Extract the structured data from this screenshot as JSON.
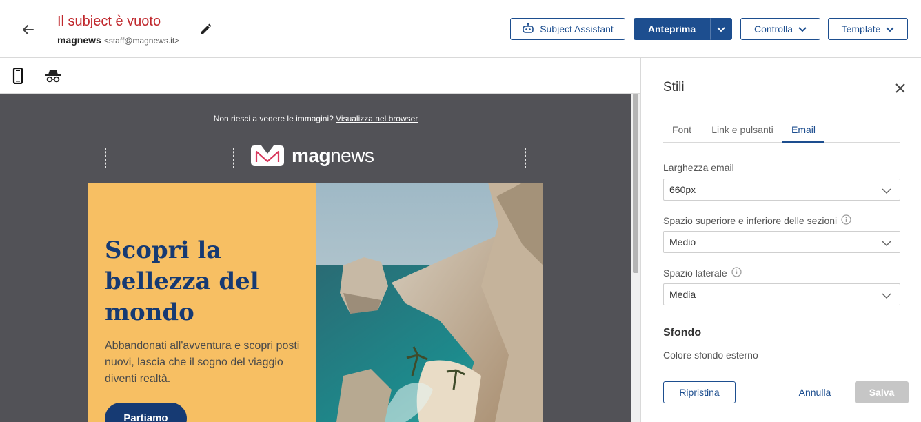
{
  "header": {
    "subject": "Il subject è vuoto",
    "sender_name": "magnews",
    "sender_email": "<staff@magnews.it>",
    "subject_assistant_label": "Subject Assistant",
    "preview_label": "Anteprima",
    "check_label": "Controlla",
    "template_label": "Template"
  },
  "email": {
    "browser_prompt": "Non riesci a vedere le immagini?",
    "browser_link": "Visualizza nel browser",
    "logo_bold": "mag",
    "logo_light": "news",
    "hero_title": "Scopri la bellezza del mondo",
    "hero_text": "Abbandonati all'avventura e scopri posti nuovi, lascia che il sogno del viaggio diventi realtà.",
    "cta_label": "Partiamo"
  },
  "panel": {
    "title": "Stili",
    "tabs": [
      {
        "label": "Font"
      },
      {
        "label": "Link e pulsanti"
      },
      {
        "label": "Email",
        "active": true
      }
    ],
    "email_width_label": "Larghezza email",
    "email_width_value": "660px",
    "section_spacing_label": "Spazio superiore e inferiore delle sezioni",
    "section_spacing_value": "Medio",
    "side_spacing_label": "Spazio laterale",
    "side_spacing_value": "Media",
    "background_title": "Sfondo",
    "background_sub": "Colore sfondo esterno",
    "reset_label": "Ripristina",
    "cancel_label": "Annulla",
    "save_label": "Salva"
  },
  "colors": {
    "brand_blue": "#1d4e8f",
    "error_red": "#c0282d",
    "hero_yellow": "#f7bf63",
    "canvas_gray": "#525257"
  },
  "icons": [
    "back-arrow-icon",
    "pencil-icon",
    "robot-icon",
    "chevron-down-icon",
    "mobile-icon",
    "incognito-icon",
    "close-icon",
    "info-icon"
  ]
}
